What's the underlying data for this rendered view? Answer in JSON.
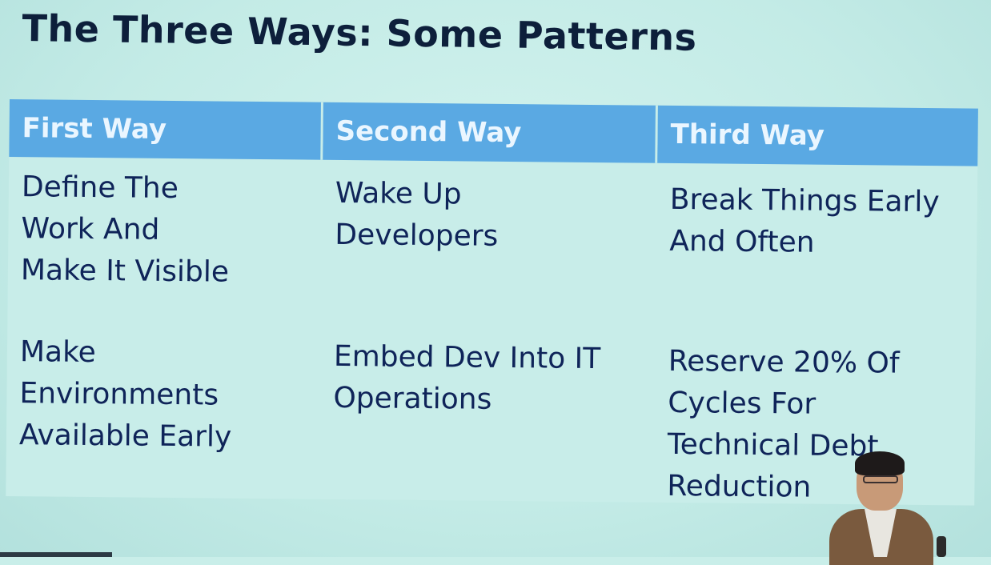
{
  "slide": {
    "title": "The Three Ways: Some Patterns",
    "table": {
      "headers": [
        "First Way",
        "Second Way",
        "Third Way"
      ],
      "rows": [
        [
          [
            "Define The",
            "Work And",
            "Make It Visible"
          ],
          [
            "Wake Up",
            "Developers"
          ],
          [
            "Break Things Early",
            "And Often"
          ]
        ],
        [
          [
            "Make",
            "Environments",
            "Available Early"
          ],
          [
            "Embed Dev Into IT",
            "Operations"
          ],
          [
            "Reserve 20% Of",
            "Cycles For",
            "Technical Debt",
            "Reduction"
          ]
        ]
      ]
    }
  },
  "colors": {
    "background": "#c3ebe6",
    "header_fill": "#5aa9e3",
    "header_text": "#eaf6ff",
    "body_text": "#0f2459",
    "title_text": "#0d1f3b"
  }
}
